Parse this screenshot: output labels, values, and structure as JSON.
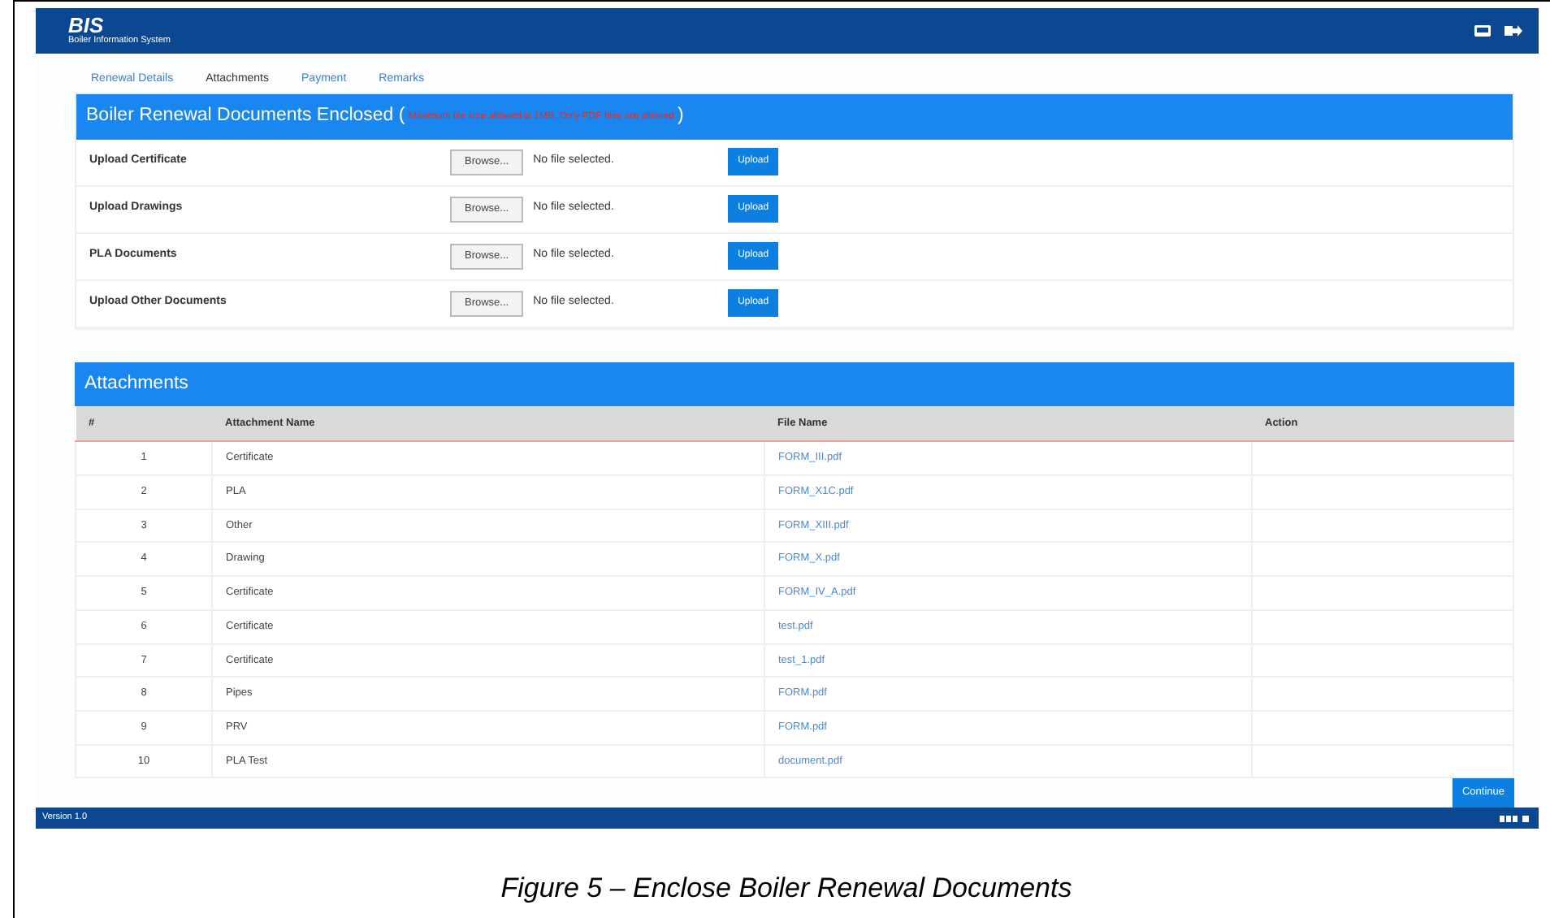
{
  "header": {
    "logo": "BIS",
    "subtitle": "Boiler Information System"
  },
  "tabs": [
    {
      "label": "Renewal Details",
      "selected": false
    },
    {
      "label": "Attachments",
      "selected": true
    },
    {
      "label": "Payment",
      "selected": false
    },
    {
      "label": "Remarks",
      "selected": false
    }
  ],
  "documents_panel": {
    "title": "Boiler Renewal Documents Enclosed (",
    "note": "Maximum file size allowed is 1MB. Only PDF files are allowed",
    "title_end": ")",
    "rows": [
      {
        "label": "Upload Certificate",
        "browse": "Browse...",
        "file_status": "No file selected.",
        "upload": "Upload"
      },
      {
        "label": "Upload Drawings",
        "browse": "Browse...",
        "file_status": "No file selected.",
        "upload": "Upload"
      },
      {
        "label": "PLA Documents",
        "browse": "Browse...",
        "file_status": "No file selected.",
        "upload": "Upload"
      },
      {
        "label": "Upload Other Documents",
        "browse": "Browse...",
        "file_status": "No file selected.",
        "upload": "Upload"
      }
    ]
  },
  "attachments_panel": {
    "title": "Attachments",
    "columns": [
      "#",
      "Attachment Name",
      "File Name",
      "Action"
    ],
    "rows": [
      [
        "1",
        "Certificate",
        "FORM_III.pdf"
      ],
      [
        "2",
        "PLA",
        "FORM_X1C.pdf"
      ],
      [
        "3",
        "Other",
        "FORM_XIII.pdf"
      ],
      [
        "4",
        "Drawing",
        "FORM_X.pdf"
      ],
      [
        "5",
        "Certificate",
        "FORM_IV_A.pdf"
      ],
      [
        "6",
        "Certificate",
        "test.pdf"
      ],
      [
        "7",
        "Certificate",
        "test_1.pdf"
      ],
      [
        "8",
        "Pipes",
        "FORM.pdf"
      ],
      [
        "9",
        "PRV",
        "FORM.pdf"
      ],
      [
        "10",
        "PLA Test",
        "document.pdf"
      ]
    ]
  },
  "continue_button": "Continue",
  "footer": {
    "version": "Version 1.0"
  },
  "caption": "Figure 5 – Enclose Boiler Renewal Documents"
}
